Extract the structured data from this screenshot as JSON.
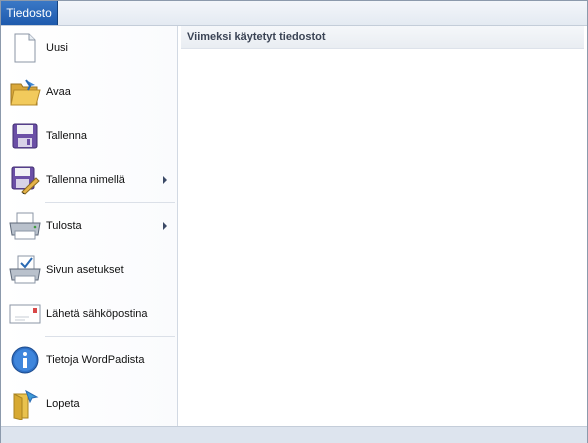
{
  "file_tab": {
    "label": "Tiedosto"
  },
  "menu": {
    "items": [
      {
        "label": "Uusi",
        "icon": "new-document-icon",
        "has_submenu": false
      },
      {
        "label": "Avaa",
        "icon": "open-folder-icon",
        "has_submenu": false
      },
      {
        "label": "Tallenna",
        "icon": "save-disk-icon",
        "has_submenu": false
      },
      {
        "label": "Tallenna nimellä",
        "icon": "save-as-icon",
        "has_submenu": true
      },
      {
        "label": "Tulosta",
        "icon": "printer-icon",
        "has_submenu": true
      },
      {
        "label": "Sivun asetukset",
        "icon": "page-setup-icon",
        "has_submenu": false
      },
      {
        "label": "Lähetä sähköpostina",
        "icon": "email-icon",
        "has_submenu": false
      },
      {
        "label": "Tietoja WordPadista",
        "icon": "info-icon",
        "has_submenu": false
      },
      {
        "label": "Lopeta",
        "icon": "exit-icon",
        "has_submenu": false
      }
    ]
  },
  "recent": {
    "title": "Viimeksi käytetyt tiedostot"
  },
  "colors": {
    "file_tab": "#1e5aad",
    "panel_border": "#d2d9e3",
    "frame": "#dfe6ef"
  }
}
